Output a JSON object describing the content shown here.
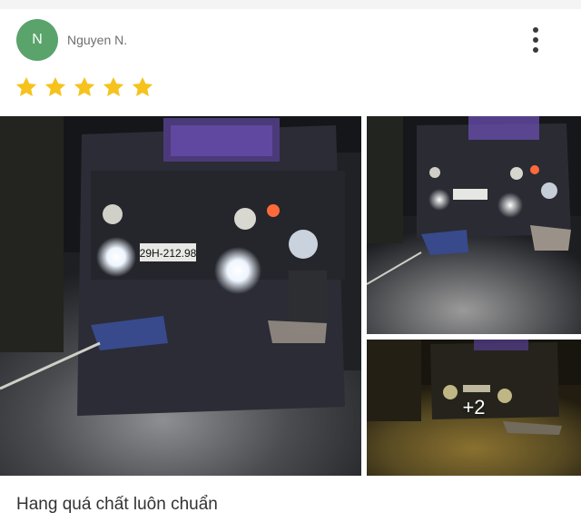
{
  "reviewer": {
    "initial": "N",
    "name": "Nguyen N.",
    "avatar_color": "#5aa36b"
  },
  "menu_icon": "more-vertical-icon",
  "rating": {
    "stars": 5,
    "max": 5,
    "star_color": "#f6c21c"
  },
  "photos": {
    "main": {
      "plate": "29H-212.98"
    },
    "second": {
      "plate": "29H-212.98"
    },
    "third": {
      "more_count": "+2"
    }
  },
  "review": {
    "text": "Hang quá chất luôn chuẩn"
  }
}
